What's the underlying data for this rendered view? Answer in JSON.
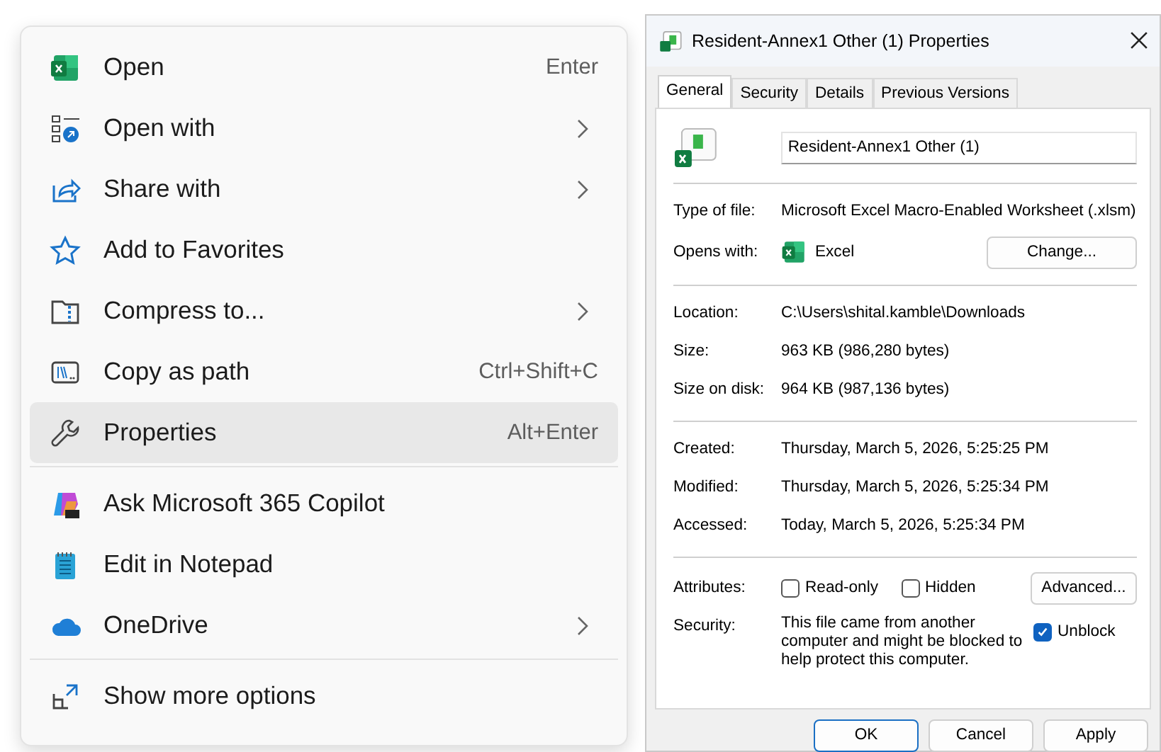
{
  "context_menu": {
    "items": [
      {
        "kind": "item",
        "label": "Open",
        "shortcut": "Enter",
        "submenu": false,
        "selected": false
      },
      {
        "kind": "item",
        "label": "Open with",
        "submenu": true,
        "selected": false
      },
      {
        "kind": "item",
        "label": "Share with",
        "submenu": true,
        "selected": false
      },
      {
        "kind": "item",
        "label": "Add to Favorites",
        "submenu": false,
        "selected": false
      },
      {
        "kind": "item",
        "label": "Compress to...",
        "submenu": true,
        "selected": false
      },
      {
        "kind": "item",
        "label": "Copy as path",
        "shortcut": "Ctrl+Shift+C",
        "submenu": false,
        "selected": false
      },
      {
        "kind": "item",
        "label": "Properties",
        "shortcut": "Alt+Enter",
        "submenu": false,
        "selected": true
      },
      {
        "kind": "separator"
      },
      {
        "kind": "item",
        "label": "Ask Microsoft 365 Copilot",
        "submenu": false,
        "selected": false
      },
      {
        "kind": "item",
        "label": "Edit in Notepad",
        "submenu": false,
        "selected": false
      },
      {
        "kind": "item",
        "label": "OneDrive",
        "submenu": true,
        "selected": false
      },
      {
        "kind": "separator"
      },
      {
        "kind": "item",
        "label": "Show more options",
        "submenu": false,
        "selected": false
      }
    ]
  },
  "dialog": {
    "title": "Resident-Annex1 Other (1) Properties",
    "tabs": [
      {
        "label": "General",
        "selected": true
      },
      {
        "label": "Security",
        "selected": false
      },
      {
        "label": "Details",
        "selected": false
      },
      {
        "label": "Previous Versions",
        "selected": false
      }
    ],
    "file_name": "Resident-Annex1 Other (1)",
    "sections": [
      [
        {
          "kind": "text",
          "label": "Type of file:",
          "value": "Microsoft Excel Macro-Enabled Worksheet (.xlsm)"
        },
        {
          "kind": "app",
          "label": "Opens with:",
          "value": "Excel",
          "button": "Change..."
        }
      ],
      [
        {
          "kind": "text",
          "label": "Location:",
          "value": "C:\\Users\\shital.kamble\\Downloads"
        },
        {
          "kind": "text",
          "label": "Size:",
          "value": "963 KB (986,280 bytes)"
        },
        {
          "kind": "text",
          "label": "Size on disk:",
          "value": "964 KB (987,136 bytes)"
        }
      ],
      [
        {
          "kind": "text",
          "label": "Created:",
          "value": "Thursday, March 5, 2026, 5:25:25 PM"
        },
        {
          "kind": "text",
          "label": "Modified:",
          "value": "Thursday, March 5, 2026, 5:25:34 PM"
        },
        {
          "kind": "text",
          "label": "Accessed:",
          "value": "Today, March 5, 2026, 5:25:34 PM"
        }
      ],
      [
        {
          "kind": "attributes",
          "label": "Attributes:",
          "checkboxes": [
            {
              "label": "Read-only",
              "checked": false
            },
            {
              "label": "Hidden",
              "checked": false
            }
          ],
          "button": "Advanced..."
        },
        {
          "kind": "security",
          "label": "Security:",
          "value": "This file came from another computer and might be blocked to help protect this computer.",
          "checkbox": {
            "label": "Unblock",
            "checked": true
          }
        }
      ]
    ],
    "buttons": [
      {
        "label": "OK",
        "default": true
      },
      {
        "label": "Cancel",
        "default": false
      },
      {
        "label": "Apply",
        "default": false
      }
    ]
  }
}
